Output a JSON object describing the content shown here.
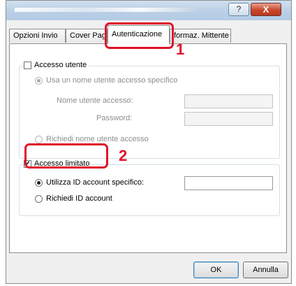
{
  "titlebar": {
    "help_symbol": "?",
    "close_symbol": "X"
  },
  "tabs": [
    {
      "label": "Opzioni Invio"
    },
    {
      "label": "Cover Pag"
    },
    {
      "label": "Autenticazione"
    },
    {
      "label": "formaz. Mittente"
    }
  ],
  "user_access": {
    "checkbox_label": "Accesso utente",
    "checked": false,
    "use_specific_label": "Usa un nome utente accesso specifico",
    "username_label": "Nome utente accesso:",
    "username_value": "",
    "password_label": "Password:",
    "password_value": "",
    "ask_username_label": "Richiedi nome utente accesso"
  },
  "limited_access": {
    "checkbox_label": "Accesso limitato",
    "checked": true,
    "check_glyph": "✔",
    "use_specific_label": "Utilizza ID account specifico:",
    "account_id_value": "",
    "ask_account_label": "Richiedi ID account"
  },
  "buttons": {
    "ok_label": "OK",
    "cancel_label": "Annulla"
  },
  "callouts": {
    "step1": "1",
    "step2": "2"
  },
  "colors": {
    "callout": "#e0142a",
    "close_button": "#c8472b"
  }
}
